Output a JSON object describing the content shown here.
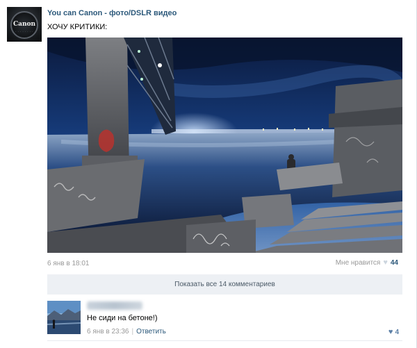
{
  "post": {
    "author": "You can Canon - фото/DSLR видео",
    "text": "ХОЧУ КРИТИКИ:",
    "avatar_brand": "Canon",
    "date": "6 янв в 18:01",
    "like_label": "Мне нравится",
    "like_count": "44",
    "photo_icon": "photo-icon"
  },
  "comments_bar": {
    "show_all_label": "Показать все 14 комментариев"
  },
  "comment": {
    "author_blurred": true,
    "text": "Не сиди на бетоне!)",
    "date": "6 янв в 23:36",
    "separator": "|",
    "reply_label": "Ответить",
    "like_count": "4"
  },
  "colors": {
    "link": "#2b587a",
    "muted": "#999999",
    "bar_bg": "#edf0f4",
    "heart_liked": "#5b7fa6",
    "heart_idle": "#cdd6df"
  }
}
